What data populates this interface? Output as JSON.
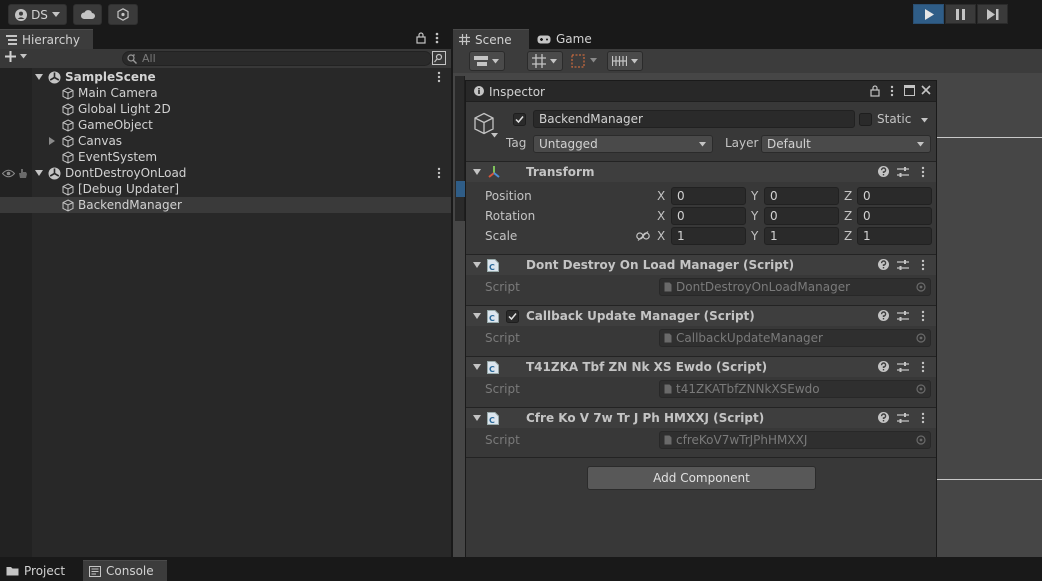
{
  "toolbar": {
    "account_label": "DS",
    "play_color": "#2f5d87"
  },
  "hierarchy": {
    "tab_label": "Hierarchy",
    "search_placeholder": "All",
    "rows": [
      {
        "label": "SampleScene",
        "type": "scene"
      },
      {
        "label": "Main Camera",
        "type": "object"
      },
      {
        "label": "Global Light 2D",
        "type": "object"
      },
      {
        "label": "GameObject",
        "type": "object"
      },
      {
        "label": "Canvas",
        "type": "object"
      },
      {
        "label": "EventSystem",
        "type": "object"
      },
      {
        "label": "DontDestroyOnLoad",
        "type": "scene"
      },
      {
        "label": "[Debug Updater]",
        "type": "object"
      },
      {
        "label": "BackendManager",
        "type": "object"
      }
    ]
  },
  "scene": {
    "tabs": [
      {
        "label": "Scene"
      },
      {
        "label": "Game"
      }
    ]
  },
  "inspector": {
    "title": "Inspector",
    "object_name": "BackendManager",
    "static_label": "Static",
    "tag_label": "Tag",
    "tag_value": "Untagged",
    "layer_label": "Layer",
    "layer_value": "Default",
    "transform": {
      "title": "Transform",
      "position_label": "Position",
      "rotation_label": "Rotation",
      "scale_label": "Scale",
      "position": {
        "x": "0",
        "y": "0",
        "z": "0"
      },
      "rotation": {
        "x": "0",
        "y": "0",
        "z": "0"
      },
      "scale": {
        "x": "1",
        "y": "1",
        "z": "1"
      },
      "axis_x": "X",
      "axis_y": "Y",
      "axis_z": "Z"
    },
    "components": [
      {
        "title": "Dont Destroy On Load Manager (Script)",
        "script_label": "Script",
        "script_value": "DontDestroyOnLoadManager"
      },
      {
        "title": "Callback Update Manager (Script)",
        "script_label": "Script",
        "script_value": "CallbackUpdateManager"
      },
      {
        "title": "T41ZKA Tbf ZN Nk XS Ewdo (Script)",
        "script_label": "Script",
        "script_value": "t41ZKATbfZNNkXSEwdo"
      },
      {
        "title": "Cfre Ko V 7w Tr J Ph HMXXJ (Script)",
        "script_label": "Script",
        "script_value": "cfreKoV7wTrJPhHMXXJ"
      }
    ],
    "add_component_label": "Add Component"
  },
  "bottom_tabs": [
    {
      "label": "Project"
    },
    {
      "label": "Console"
    }
  ]
}
